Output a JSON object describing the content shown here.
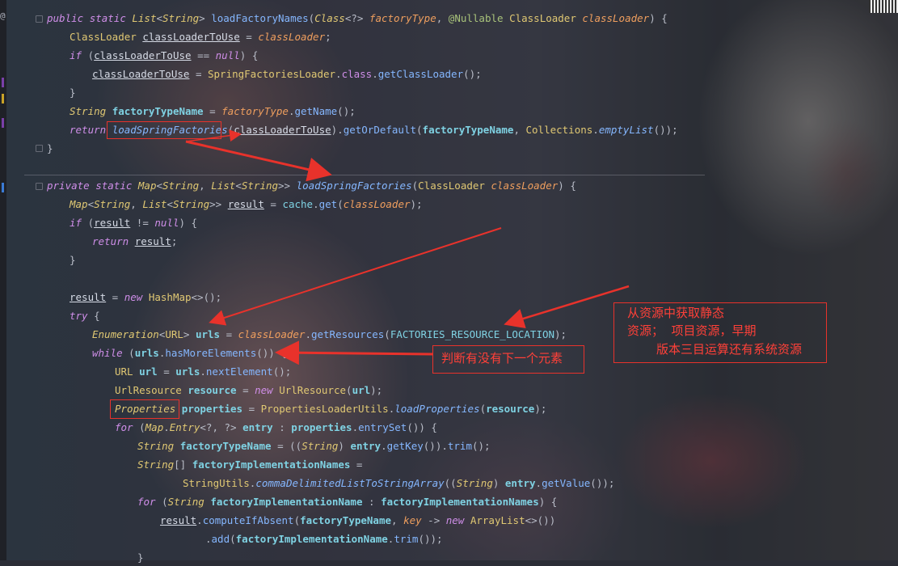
{
  "editor": {
    "language": "Java",
    "colors": {
      "keyword": "#cf8ee8",
      "type": "#e0c873",
      "method": "#85b7ff",
      "parameter": "#ee9e5e",
      "field": "#7fd2e3",
      "annotation_color": "#e8322b"
    },
    "gutter_symbol": "@",
    "lines": [
      {
        "id": "l1",
        "text": "public static List<String> loadFactoryNames(Class<?> factoryType, @Nullable ClassLoader classLoader) {"
      },
      {
        "id": "l2",
        "text": "ClassLoader classLoaderToUse = classLoader;"
      },
      {
        "id": "l3",
        "text": "if (classLoaderToUse == null) {"
      },
      {
        "id": "l4",
        "text": "classLoaderToUse = SpringFactoriesLoader.class.getClassLoader();"
      },
      {
        "id": "l5",
        "text": "}"
      },
      {
        "id": "l6",
        "text": "String factoryTypeName = factoryType.getName();"
      },
      {
        "id": "l7",
        "text": "return loadSpringFactories(classLoaderToUse).getOrDefault(factoryTypeName, Collections.emptyList());"
      },
      {
        "id": "l8",
        "text": "}"
      },
      {
        "id": "l9",
        "text": "private static Map<String, List<String>> loadSpringFactories(ClassLoader classLoader) {"
      },
      {
        "id": "l10",
        "text": "Map<String, List<String>> result = cache.get(classLoader);"
      },
      {
        "id": "l11",
        "text": "if (result != null) {"
      },
      {
        "id": "l12",
        "text": "return result;"
      },
      {
        "id": "l13",
        "text": "}"
      },
      {
        "id": "l14",
        "text": "result = new HashMap<>();"
      },
      {
        "id": "l15",
        "text": "try {"
      },
      {
        "id": "l16",
        "text": "Enumeration<URL> urls = classLoader.getResources(FACTORIES_RESOURCE_LOCATION);"
      },
      {
        "id": "l17",
        "text": "while (urls.hasMoreElements()) {"
      },
      {
        "id": "l18",
        "text": "URL url = urls.nextElement();"
      },
      {
        "id": "l19",
        "text": "UrlResource resource = new UrlResource(url);"
      },
      {
        "id": "l20",
        "text": "Properties properties = PropertiesLoaderUtils.loadProperties(resource);"
      },
      {
        "id": "l21",
        "text": "for (Map.Entry<?, ?> entry : properties.entrySet()) {"
      },
      {
        "id": "l22",
        "text": "String factoryTypeName = ((String) entry.getKey()).trim();"
      },
      {
        "id": "l23",
        "text": "String[] factoryImplementationNames ="
      },
      {
        "id": "l24",
        "text": "StringUtils.commaDelimitedListToStringArray((String) entry.getValue());"
      },
      {
        "id": "l25",
        "text": "for (String factoryImplementationName : factoryImplementationNames) {"
      },
      {
        "id": "l26",
        "text": "result.computeIfAbsent(factoryTypeName, key -> new ArrayList<>())"
      },
      {
        "id": "l27",
        "text": ".add(factoryImplementationName.trim());"
      },
      {
        "id": "l28",
        "text": "}"
      }
    ]
  },
  "annotations": {
    "note_has_next": "判断有没有下一个元素",
    "note_resource_line1": "从资源中获取静态",
    "note_resource_line2": "资源；  项目资源，早期",
    "note_resource_line3": "版本三目运算还有系统资源"
  }
}
